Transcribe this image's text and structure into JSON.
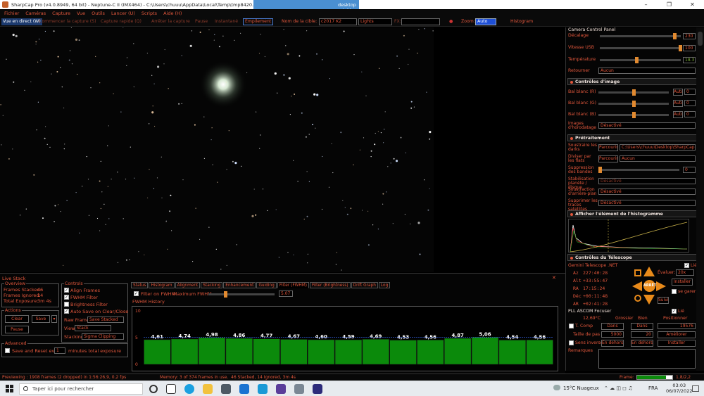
{
  "titlebar": {
    "title": "SharpCap Pro (v4.0.8949, 64 bit) - Neptune-C II (IMX464) - C:\\Users\\chuuu\\AppData\\Local\\Temp\\tmp8420.tmp.png - C:\\Users\\",
    "ghost_title": "desktop rxjg1l"
  },
  "menu": [
    "Fichier",
    "Caméras",
    "Capture",
    "Vue",
    "Outils",
    "Lancer (U)",
    "Scripts",
    "Aide (H)"
  ],
  "toolbar": {
    "live_view": "Vue en direct (W)",
    "start_capture": "Commencer la capture (S)",
    "quick_capture": "Capture rapide (Q)",
    "stop_capture": "Arrêter la capture",
    "pause": "Pause",
    "snapshot": "Instantané",
    "stacking": "Empilement",
    "target_label": "Nom de la cible:",
    "target_value": "c2017 K2",
    "frame_type": "Lights",
    "fx_label": "FX:",
    "fx_value": "",
    "zoom_label": "Zoom:",
    "zoom_value": "Auto",
    "histogram": "Histogram"
  },
  "camera_control": {
    "title": "Camera Control Panel",
    "offset_label": "Décalage",
    "offset_value": "230",
    "usb_label": "Vitesse USB",
    "usb_value": "100",
    "temp_label": "Température",
    "temp_value": "18.3",
    "flip_label": "Retourner",
    "flip_value": "Aucun"
  },
  "image_controls": {
    "title": "Contrôles d'image",
    "wb_r": "Bal blanc (R)",
    "wb_g": "Bal blanc (G)",
    "wb_b": "Bal blanc (B)",
    "auto": "Auto",
    "wb_r_value": "0",
    "wb_g_value": "0",
    "wb_b_value": "0",
    "timestamp_label": "Images d'horodatage",
    "timestamp_value": "Désactivé"
  },
  "preprocessing": {
    "title": "Prétraitement",
    "dark_label": "Soustraire les darks",
    "browse": "Parcourir...",
    "dark_value": "C:\\Users\\chuuu\\Desktop\\SharpCap...",
    "flat_label": "Diviser par les flats",
    "flat_value": "Aucun",
    "banding_label": "Suppression des bandes",
    "banding_value": "0",
    "stab_label": "Stabilisation planète / disque",
    "stab_value": "Désactivé",
    "bg_label": "Soustraction d'arrière-plan",
    "bg_value": "Désactivé",
    "sat_label": "Supprimer les traces satellites",
    "sat_value": "Désactivé"
  },
  "histogram_panel": {
    "title": "Afficher l'élément de l'histogramme"
  },
  "telescope": {
    "title": "Contrôles du Télescope",
    "name": "Gemini Telescope .NET",
    "link": "Lié",
    "az_label": "Az",
    "az": "227:40:28",
    "alt_label": "Alt",
    "alt": "+33:55:47",
    "ra_label": "RA",
    "ra": "17:15:24",
    "dec_label": "Déc",
    "dec": "+00:11:48",
    "ar_label": "AR",
    "ar": "+02:41:28",
    "rate_label": "Évaluer:",
    "rate_value": "20x",
    "install": "Installer",
    "park": "se garer",
    "center": "ARRÊT",
    "follow": "Suivi"
  },
  "focuser": {
    "title": "PLL ASCOM Focuser",
    "link": "Lié",
    "temp": "12,69°C",
    "coarse": "Grossier",
    "fine": "Bien",
    "position": "Positionner",
    "tcomp": "T. Comp",
    "in": "Dans",
    "pos_value": "19576",
    "step_label": "Taille de pas",
    "step_coarse": "5000",
    "step_fine": "20",
    "improve": "Améliorer",
    "reverse": "Sens inverse",
    "out": "En dehors",
    "install": "Installer",
    "remarks": "Remarques"
  },
  "live_stack": {
    "title": "Live Stack",
    "overview_title": "Overview",
    "frames_stacked_label": "Frames Stacked:",
    "frames_stacked": "46",
    "frames_ignored_label": "Frames Ignored:",
    "frames_ignored": "14",
    "total_exposure_label": "Total Exposure:",
    "total_exposure": "3m 4s",
    "actions_title": "Actions",
    "clear": "Clear",
    "save": "Save",
    "pause": "Pause",
    "controls_title": "Controls",
    "align": "Align Frames",
    "fwhm_filter": "FWHM Filter",
    "brightness_filter": "Brightness Filter",
    "auto_save": "Auto Save on Clear/Close",
    "raw_frames_label": "Raw Frames",
    "raw_frames": "Save Stacked",
    "view_label": "View",
    "view": "Stack",
    "stacking_label": "Stacking",
    "stacking": "Sigma Clipping",
    "advanced_title": "Advanced",
    "save_reset": "Save and Reset every",
    "save_reset_value": "1",
    "minutes": "minutes total exposure",
    "tabs": [
      "Status",
      "Histogram",
      "Alignment",
      "Stacking",
      "Enhancement",
      "Guiding",
      "Filter (FWHM)",
      "Filter (Brightness)",
      "Drift Graph",
      "Log"
    ],
    "filter_on": "Filter on FWHM",
    "max_fwhm_label": "Maximum FWHM",
    "max_fwhm_value": "5.07",
    "history_title": "FWHM History"
  },
  "chart_data": {
    "type": "bar",
    "title": "FWHM History",
    "ylim": [
      0,
      10
    ],
    "yticks": [
      "0",
      "5",
      "10"
    ],
    "values": [
      4.61,
      4.74,
      4.98,
      4.86,
      4.77,
      4.67,
      4.6,
      4.59,
      4.69,
      4.53,
      4.56,
      4.87,
      5.06,
      4.54,
      4.56
    ],
    "labels": [
      "4,61",
      "4,74",
      "4,98",
      "4,86",
      "4,77",
      "4,67",
      "4,60",
      "4,59",
      "4,69",
      "4,53",
      "4,56",
      "4,87",
      "5,06",
      "4,54",
      "4,56"
    ],
    "threshold": 5.07,
    "bar_color": "#0b8a0b"
  },
  "status": {
    "preview": "Previewing : 1908 frames (2 dropped) in 1:56:26,9, 0,2 fps",
    "memory": "Memory: 3 of 374 frames in use.",
    "stacked": "46 Stacked, 14 Ignored, 3m 4s",
    "frame_label": "Frame:",
    "frame_value": "1,8/2,2"
  },
  "taskbar": {
    "search": "Taper ici pour rechercher",
    "weather": "15°C Nuageux",
    "lang": "FRA",
    "time": "03:03",
    "date": "06/07/2022"
  }
}
